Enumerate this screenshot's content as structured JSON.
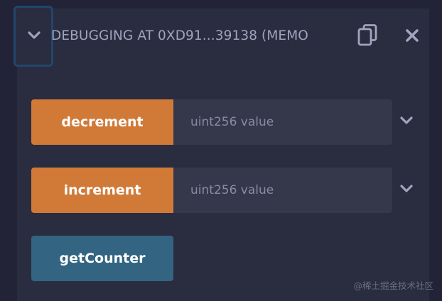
{
  "header": {
    "title": "DEBUGGING AT 0XD91...39138 (MEMO",
    "collapse_icon": "chevron-down-icon",
    "copy_icon": "copy-icon",
    "close_icon": "close-icon"
  },
  "functions": [
    {
      "label": "decrement",
      "placeholder": "uint256 value",
      "color": "#d17a38"
    },
    {
      "label": "increment",
      "placeholder": "uint256 value",
      "color": "#d17a38"
    },
    {
      "label": "getCounter",
      "color": "#336482"
    }
  ],
  "colors": {
    "background": "#222336",
    "panel": "#2a2c3f",
    "input": "#35374b",
    "focus_ring": "#21476a",
    "text_muted": "#a2a3bd"
  },
  "watermark": "@稀土掘金技术社区"
}
